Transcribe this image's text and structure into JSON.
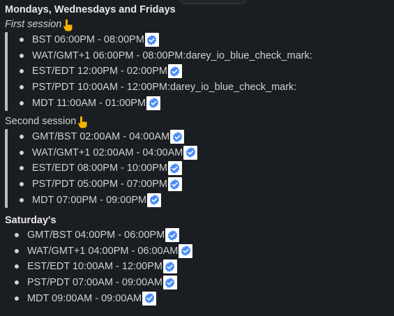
{
  "heading": "Mondays, Wednesdays and Fridays",
  "colors": {
    "background": "#1a1d21",
    "text": "#d1d2d3",
    "quote_bar": "#bdbdbd",
    "check_blue": "#4a8df8"
  },
  "first_session": {
    "title": "First session",
    "icon": "pointing-down-hand-icon",
    "items": [
      {
        "text": "BST 06:00PM - 08:00PM",
        "check": true
      },
      {
        "text": "WAT/GMT+1 06:00PM - 08:00PM:darey_io_blue_check_mark:",
        "check": false
      },
      {
        "text": "EST/EDT 12:00PM - 02:00PM",
        "check": true
      },
      {
        "text": "PST/PDT 10:00AM - 12:00PM:darey_io_blue_check_mark:",
        "check": false
      },
      {
        "text": "MDT 11:00AM - 01:00PM",
        "check": true
      }
    ]
  },
  "second_session": {
    "title": "Second session",
    "icon": "pointing-down-hand-icon",
    "items": [
      {
        "text": "GMT/BST 02:00AM - 04:00AM",
        "check": true
      },
      {
        "text": "WAT/GMT+1 02:00AM - 04:00AM",
        "check": true
      },
      {
        "text": "EST/EDT 08:00PM - 10:00PM",
        "check": true
      },
      {
        "text": "PST/PDT 05:00PM - 07:00PM",
        "check": true
      },
      {
        "text": "MDT 07:00PM - 09:00PM",
        "check": true
      }
    ]
  },
  "saturday": {
    "title": "Saturday's",
    "items": [
      {
        "text": "GMT/BST 04:00PM - 06:00PM",
        "check": true
      },
      {
        "text": "WAT/GMT+1 04:00PM - 06:00AM",
        "check": true
      },
      {
        "text": "EST/EDT 10:00AM - 12:00PM",
        "check": true
      },
      {
        "text": "PST/PDT 07:00AM - 09:00AM",
        "check": true
      },
      {
        "text": "MDT 09:00AM - 09:00AM",
        "check": true
      }
    ]
  }
}
